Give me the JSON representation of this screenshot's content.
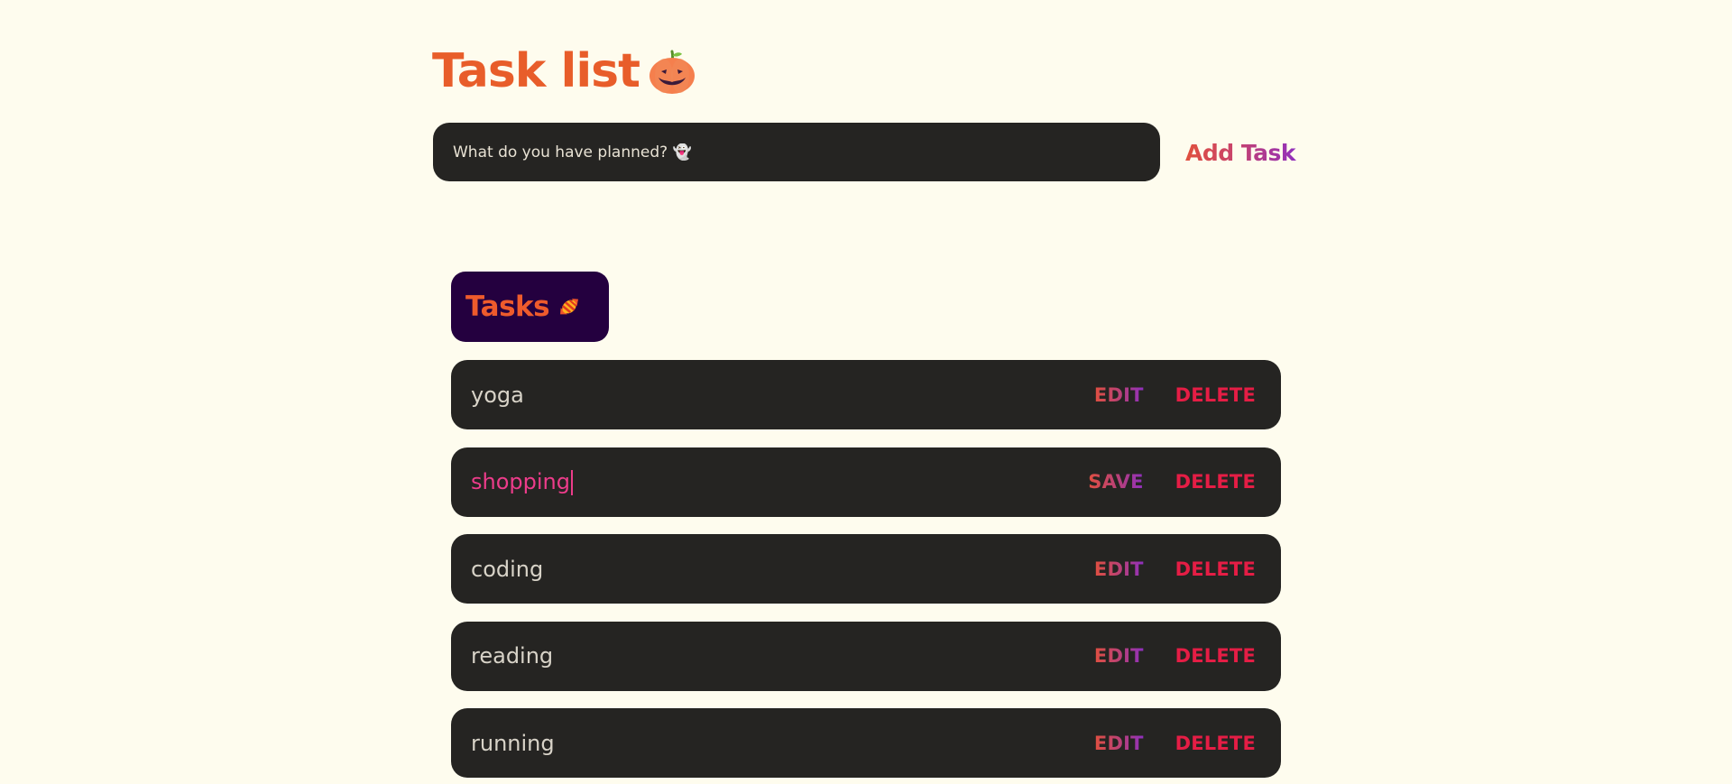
{
  "header": {
    "title": "Task list",
    "title_icon": "pumpkin-icon"
  },
  "new_task": {
    "placeholder": "What do you have planned? 👻",
    "value": "",
    "add_label": "Add Task"
  },
  "tasks_section": {
    "title": "Tasks",
    "title_icon": "candy-icon"
  },
  "tasks": [
    {
      "text": "yoga",
      "edit_label": "EDIT",
      "delete_label": "DELETE",
      "editing": false
    },
    {
      "text": "shopping",
      "edit_label": "SAVE",
      "delete_label": "DELETE",
      "editing": true
    },
    {
      "text": "coding",
      "edit_label": "EDIT",
      "delete_label": "DELETE",
      "editing": false
    },
    {
      "text": "reading",
      "edit_label": "EDIT",
      "delete_label": "DELETE",
      "editing": false
    },
    {
      "text": "running",
      "edit_label": "EDIT",
      "delete_label": "DELETE",
      "editing": false
    }
  ],
  "colors": {
    "background": "#fefcee",
    "title": "#e85d2a",
    "card": "#252422",
    "tasks_header_bg": "#24003f",
    "delete": "#e51d45",
    "editing_text": "#ec3c8a",
    "accent_gradient_start": "#e2513a",
    "accent_gradient_end": "#8e2fc0"
  }
}
